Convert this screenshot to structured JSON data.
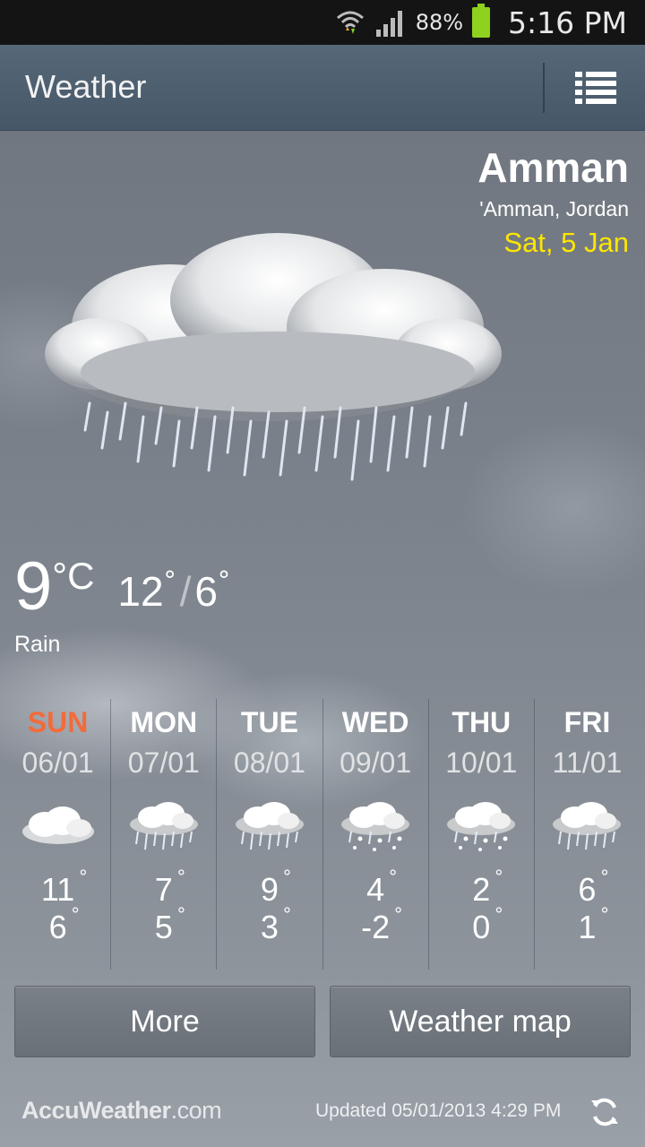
{
  "status_bar": {
    "battery_pct": "88%",
    "time": "5:16 PM",
    "icons": [
      "wifi-icon",
      "signal-icon",
      "battery-icon"
    ]
  },
  "action_bar": {
    "title": "Weather",
    "menu_icon": "list-menu-icon"
  },
  "location": {
    "city": "Amman",
    "region": "'Amman, Jordan",
    "date": "Sat, 5 Jan"
  },
  "current": {
    "temp": "9",
    "unit": "°C",
    "high": "12",
    "low": "6",
    "condition": "Rain",
    "icon": "rain-cloud-icon"
  },
  "forecast": [
    {
      "day": "SUN",
      "date": "06/01",
      "high": "11",
      "low": "6",
      "icon": "cloud-icon",
      "today": true
    },
    {
      "day": "MON",
      "date": "07/01",
      "high": "7",
      "low": "5",
      "icon": "rain-icon"
    },
    {
      "day": "TUE",
      "date": "08/01",
      "high": "9",
      "low": "3",
      "icon": "rain-icon"
    },
    {
      "day": "WED",
      "date": "09/01",
      "high": "4",
      "low": "-2",
      "icon": "snow-rain-icon"
    },
    {
      "day": "THU",
      "date": "10/01",
      "high": "2",
      "low": "0",
      "icon": "snow-rain-icon"
    },
    {
      "day": "FRI",
      "date": "11/01",
      "high": "6",
      "low": "1",
      "icon": "rain-icon"
    }
  ],
  "buttons": {
    "more": "More",
    "map": "Weather map"
  },
  "footer": {
    "brand_main": "AccuWeather",
    "brand_suffix": ".com",
    "updated": "Updated 05/01/2013 4:29 PM"
  },
  "colors": {
    "today_accent": "#f26b3a",
    "date_accent": "#ffe600",
    "battery": "#8fd11f",
    "action_bar": "#4e6070"
  }
}
